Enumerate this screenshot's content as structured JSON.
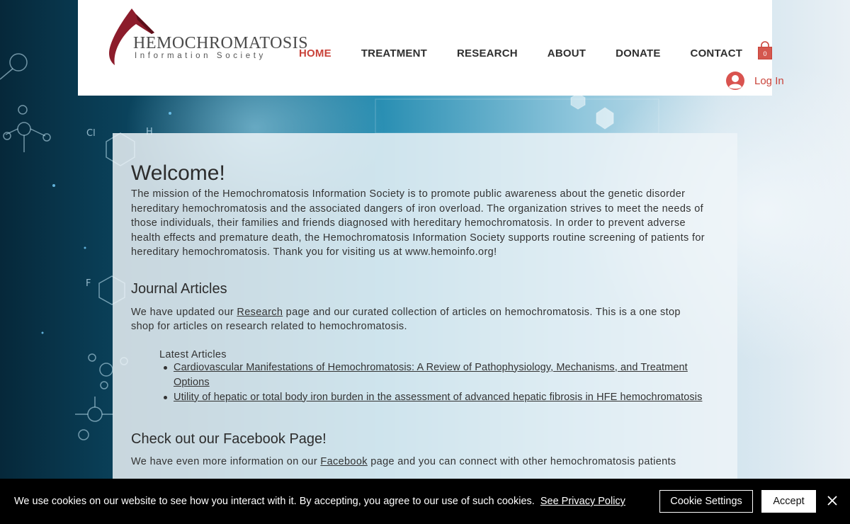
{
  "brand": {
    "title": "HEMOCHROMATOSIS",
    "subtitle": "Information Society",
    "colors": {
      "accent": "#c9433a",
      "logo_red": "#8c1c2b"
    }
  },
  "nav": {
    "items": [
      {
        "label": "HOME",
        "active": true
      },
      {
        "label": "TREATMENT"
      },
      {
        "label": "RESEARCH"
      },
      {
        "label": "ABOUT"
      },
      {
        "label": "DONATE"
      },
      {
        "label": "CONTACT"
      }
    ],
    "cart_count": "0",
    "cart_icon": "shopping-bag-icon",
    "login_label": "Log In",
    "avatar_icon": "user-avatar-icon"
  },
  "welcome": {
    "heading": "Welcome!",
    "text": "The mission of the Hemochromatosis Information Society is to promote public awareness about the genetic disorder hereditary hemochromatosis and the associated dangers of iron overload. The organization strives to meet the needs of those individuals, their families and friends diagnosed with hereditary hemochromatosis. In order to prevent adverse health effects and premature death, the Hemochromatosis Information Society supports routine screening of patients for hereditary hemochromatosis. Thank you for visiting us at www.hemoinfo.org!"
  },
  "journal": {
    "heading": "Journal Articles",
    "text_before": "We have updated our ",
    "link": "Research",
    "text_after": " page and our curated collection of articles on hemochromatosis.  This is a one stop shop for articles on research related to hemochromatosis.",
    "latest_label": "Latest Articles",
    "articles": [
      "Cardiovascular Manifestations of Hemochromatosis: A Review of Pathophysiology, Mechanisms, and Treatment Options",
      "Utility of hepatic or total body iron burden in the assessment of advanced hepatic fibrosis in HFE hemochromatosis"
    ]
  },
  "facebook": {
    "heading": "Check out our Facebook Page!",
    "text_before": "We have even more information on our ",
    "link": "Facebook",
    "text_after": " page and you can connect with other hemochromatosis patients"
  },
  "cookie": {
    "text": "We use cookies on our website to see how you interact with it. By accepting, you agree to our use of such cookies.",
    "policy_link": "See Privacy Policy",
    "settings_label": "Cookie Settings",
    "accept_label": "Accept",
    "close_icon": "close-icon"
  }
}
